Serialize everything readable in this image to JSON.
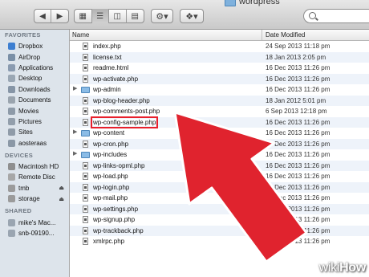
{
  "window": {
    "title": "wordpress"
  },
  "toolbar": {
    "back_icon": "chevron-left-icon",
    "forward_icon": "chevron-right-icon",
    "action_icon": "gear-icon",
    "dropbox_icon": "dropbox-icon",
    "view_icons": [
      "icon-view-icon",
      "list-view-icon",
      "column-view-icon",
      "coverflow-view-icon"
    ]
  },
  "sidebar": {
    "sections": [
      {
        "title": "FAVORITES",
        "items": [
          {
            "label": "Dropbox",
            "icon": "dropbox-icon",
            "color": "#3d7fd1"
          },
          {
            "label": "AirDrop",
            "icon": "airdrop-icon",
            "color": "#7a8fa6"
          },
          {
            "label": "Applications",
            "icon": "applications-icon",
            "color": "#8a9bb0"
          },
          {
            "label": "Desktop",
            "icon": "desktop-icon",
            "color": "#9aa7b4"
          },
          {
            "label": "Downloads",
            "icon": "downloads-icon",
            "color": "#8695a6"
          },
          {
            "label": "Documents",
            "icon": "documents-icon",
            "color": "#9aa4ae"
          },
          {
            "label": "Movies",
            "icon": "movies-icon",
            "color": "#8d9aa8"
          },
          {
            "label": "Pictures",
            "icon": "pictures-icon",
            "color": "#929eab"
          },
          {
            "label": "Sites",
            "icon": "sites-icon",
            "color": "#8f9ba8"
          },
          {
            "label": "aosteraas",
            "icon": "home-icon",
            "color": "#8b98a6"
          }
        ]
      },
      {
        "title": "DEVICES",
        "items": [
          {
            "label": "Macintosh HD",
            "icon": "hard-disk-icon",
            "color": "#8f8f8f",
            "eject": false
          },
          {
            "label": "Remote Disc",
            "icon": "remote-disc-icon",
            "color": "#a7a7a7",
            "eject": false
          },
          {
            "label": "tmb",
            "icon": "external-drive-icon",
            "color": "#9b9b9b",
            "eject": true
          },
          {
            "label": "storage",
            "icon": "external-drive-icon",
            "color": "#9b9b9b",
            "eject": true
          }
        ]
      },
      {
        "title": "SHARED",
        "items": [
          {
            "label": "mike's Mac...",
            "icon": "shared-computer-icon",
            "color": "#9aa5b1"
          },
          {
            "label": "snb-09190...",
            "icon": "shared-computer-icon",
            "color": "#9aa5b1"
          }
        ]
      }
    ]
  },
  "list": {
    "columns": {
      "name": "Name",
      "date": "Date Modified"
    },
    "rows": [
      {
        "name": "index.php",
        "date": "24 Sep 2013 11:18 pm",
        "type": "file"
      },
      {
        "name": "license.txt",
        "date": "18 Jan 2013 2:05 pm",
        "type": "file"
      },
      {
        "name": "readme.html",
        "date": "16 Dec 2013 11:26 pm",
        "type": "file"
      },
      {
        "name": "wp-activate.php",
        "date": "16 Dec 2013 11:26 pm",
        "type": "file"
      },
      {
        "name": "wp-admin",
        "date": "16 Dec 2013 11:26 pm",
        "type": "folder"
      },
      {
        "name": "wp-blog-header.php",
        "date": "18 Jan 2012 5:01 pm",
        "type": "file"
      },
      {
        "name": "wp-comments-post.php",
        "date": "6 Sep 2013 12:18 pm",
        "type": "file"
      },
      {
        "name": "wp-config-sample.php",
        "date": "16 Dec 2013 11:26 pm",
        "type": "file",
        "highlight": true
      },
      {
        "name": "wp-content",
        "date": "16 Dec 2013 11:26 pm",
        "type": "folder"
      },
      {
        "name": "wp-cron.php",
        "date": "16 Dec 2013 11:26 pm",
        "type": "file"
      },
      {
        "name": "wp-includes",
        "date": "16 Dec 2013 11:26 pm",
        "type": "folder"
      },
      {
        "name": "wp-links-opml.php",
        "date": "16 Dec 2013 11:26 pm",
        "type": "file"
      },
      {
        "name": "wp-load.php",
        "date": "16 Dec 2013 11:26 pm",
        "type": "file"
      },
      {
        "name": "wp-login.php",
        "date": "16 Dec 2013 11:26 pm",
        "type": "file"
      },
      {
        "name": "wp-mail.php",
        "date": "16 Dec 2013 11:26 pm",
        "type": "file"
      },
      {
        "name": "wp-settings.php",
        "date": "16 Dec 2013 11:26 pm",
        "type": "file"
      },
      {
        "name": "wp-signup.php",
        "date": "16 Dec 2013 11:26 pm",
        "type": "file"
      },
      {
        "name": "wp-trackback.php",
        "date": "16 Dec 2013 11:26 pm",
        "type": "file"
      },
      {
        "name": "xmlrpc.php",
        "date": "16 Dec 2013 11:26 pm",
        "type": "file"
      }
    ]
  },
  "annotation": {
    "arrow_color": "#e0232e",
    "highlight_color": "#e8202b"
  },
  "watermark": {
    "prefix": "wiki",
    "suffix": "How"
  }
}
